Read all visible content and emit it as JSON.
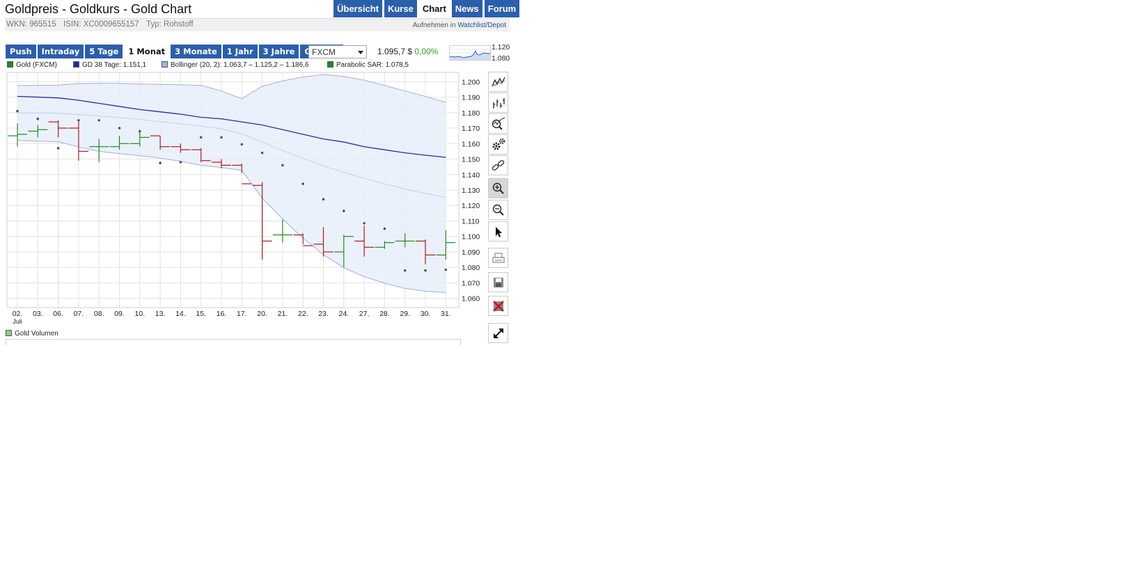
{
  "page": {
    "title": "Goldpreis - Goldkurs - Gold Chart",
    "nav_tabs": [
      {
        "label": "Übersicht",
        "active": false
      },
      {
        "label": "Kurse",
        "active": false
      },
      {
        "label": "Chart",
        "active": true
      },
      {
        "label": "News",
        "active": false
      },
      {
        "label": "Forum",
        "active": false
      }
    ],
    "wkn": "WKN: 965515",
    "isin": "ISIN: XC0009655157",
    "typ": "Typ: Rohstoff",
    "watchlist_prefix": "Aufnehmen in",
    "watchlist_link": "Watchlist/Depot"
  },
  "ranges": [
    {
      "label": "Push",
      "active": false
    },
    {
      "label": "Intraday",
      "active": false
    },
    {
      "label": "5 Tage",
      "active": false
    },
    {
      "label": "1 Monat",
      "active": true
    },
    {
      "label": "3 Monate",
      "active": false
    },
    {
      "label": "1 Jahr",
      "active": false
    },
    {
      "label": "3 Jahre",
      "active": false
    },
    {
      "label": "Gesamt",
      "active": false
    }
  ],
  "exchange_select": {
    "selected": "FXCM"
  },
  "quote": {
    "price": "1.095,7 $",
    "change": "0,00%"
  },
  "mini_chart": {
    "high_label": "1.120",
    "low_label": "1.080"
  },
  "legend": [
    {
      "label": "Gold (FXCM)",
      "color": "#1e8a1e"
    },
    {
      "label": "GD 38 Tage: 1.151,1",
      "color": "#1a2aa8"
    },
    {
      "label": "Bollinger (20, 2): 1.063,7 – 1.125,2 – 1.186,6",
      "color": "#9fb4e0"
    },
    {
      "label": "Parabolic SAR: 1.078,5",
      "color": "#1e8a1e"
    }
  ],
  "volume_legend": {
    "label": "Gold Volumen"
  },
  "colors": {
    "up": "#1e8a1e",
    "down": "#b01818",
    "ma": "#2030a8",
    "band_line": "#9fb0d8",
    "band_fill": "#e8effa",
    "grid": "#e2e2e2",
    "accent": "#2b5fac"
  },
  "toolbar_icons": [
    "line-chart-icon",
    "ohlc-chart-icon",
    "indicator-icon",
    "settings-icon",
    "link-icon",
    "zoom-in-icon",
    "zoom-out-icon",
    "pointer-icon",
    "print-icon",
    "save-icon",
    "delete-icon",
    "expand-icon"
  ],
  "chart_data": {
    "type": "ohlc",
    "x_labels": [
      "02.",
      "03.",
      "06.",
      "07.",
      "08.",
      "09.",
      "10.",
      "13.",
      "14.",
      "15.",
      "16.",
      "17.",
      "20.",
      "21.",
      "22.",
      "23.",
      "24.",
      "27.",
      "28.",
      "29.",
      "30.",
      "31."
    ],
    "x_sublabel": "Juli",
    "y_ticks": [
      "1.200",
      "1.190",
      "1.180",
      "1.170",
      "1.160",
      "1.150",
      "1.140",
      "1.130",
      "1.120",
      "1.110",
      "1.100",
      "1.090",
      "1.080",
      "1.070",
      "1.060"
    ],
    "ylim": [
      1054,
      1206
    ],
    "series": [
      {
        "name": "Gold (FXCM)",
        "open": [
          1165,
          1168,
          1174,
          1170,
          1158,
          1158,
          1160,
          1165,
          1158,
          1156,
          1148,
          1146,
          1133,
          1101,
          1101,
          1095,
          1090,
          1097,
          1093,
          1097,
          1097,
          1088
        ],
        "high": [
          1173,
          1172,
          1175,
          1174,
          1163,
          1165,
          1168,
          1165,
          1160,
          1157,
          1150,
          1147,
          1135,
          1111,
          1102,
          1106,
          1101,
          1107,
          1097,
          1102,
          1098,
          1104
        ],
        "low": [
          1158,
          1164,
          1164,
          1149,
          1148,
          1156,
          1158,
          1156,
          1154,
          1148,
          1144,
          1141,
          1085,
          1096,
          1095,
          1087,
          1080,
          1087,
          1092,
          1093,
          1082,
          1085
        ],
        "close": [
          1166,
          1169,
          1170,
          1155,
          1158,
          1160,
          1164,
          1158,
          1156,
          1149,
          1146,
          1134,
          1097,
          1101,
          1094,
          1090,
          1100,
          1093,
          1096,
          1097,
          1088,
          1096
        ]
      },
      {
        "name": "GD 38 Tage",
        "values": [
          1190.5,
          1190,
          1189.5,
          1188,
          1186,
          1184,
          1182,
          1180.5,
          1179,
          1177,
          1176,
          1174,
          1172,
          1169,
          1166,
          1163,
          1161,
          1158,
          1156,
          1154,
          1152.5,
          1151.1
        ]
      },
      {
        "name": "Bollinger upper",
        "values": [
          1197.5,
          1197.6,
          1197.8,
          1198.8,
          1198.9,
          1198.9,
          1198.5,
          1198.3,
          1198,
          1197.6,
          1194,
          1189,
          1197,
          1200.5,
          1203,
          1204.6,
          1203.4,
          1201,
          1197.5,
          1194,
          1190.5,
          1186.6
        ]
      },
      {
        "name": "Bollinger middle",
        "values": [
          1179.8,
          1179.8,
          1179.6,
          1178.8,
          1177.8,
          1176.8,
          1175.6,
          1174.2,
          1172.8,
          1171.3,
          1169.5,
          1166.3,
          1161,
          1155.5,
          1150.5,
          1145.5,
          1141.5,
          1137.5,
          1134,
          1130.6,
          1127.8,
          1125.2
        ]
      },
      {
        "name": "Bollinger lower",
        "values": [
          1162,
          1161.6,
          1161.2,
          1157.8,
          1155,
          1153.5,
          1152.2,
          1150.6,
          1148.5,
          1146,
          1144.5,
          1142.7,
          1124.8,
          1111.3,
          1099,
          1088.2,
          1079.8,
          1074,
          1069.8,
          1066.4,
          1064.6,
          1063.7
        ]
      },
      {
        "name": "Parabolic SAR",
        "values": [
          1181,
          1176,
          1157,
          1175,
          1175,
          1170,
          1168,
          1147.5,
          1148,
          1164,
          1164,
          1159.5,
          1154,
          1146,
          1134,
          1124,
          1116.5,
          1108.5,
          1105,
          1078,
          1078,
          1078.5
        ]
      }
    ]
  }
}
